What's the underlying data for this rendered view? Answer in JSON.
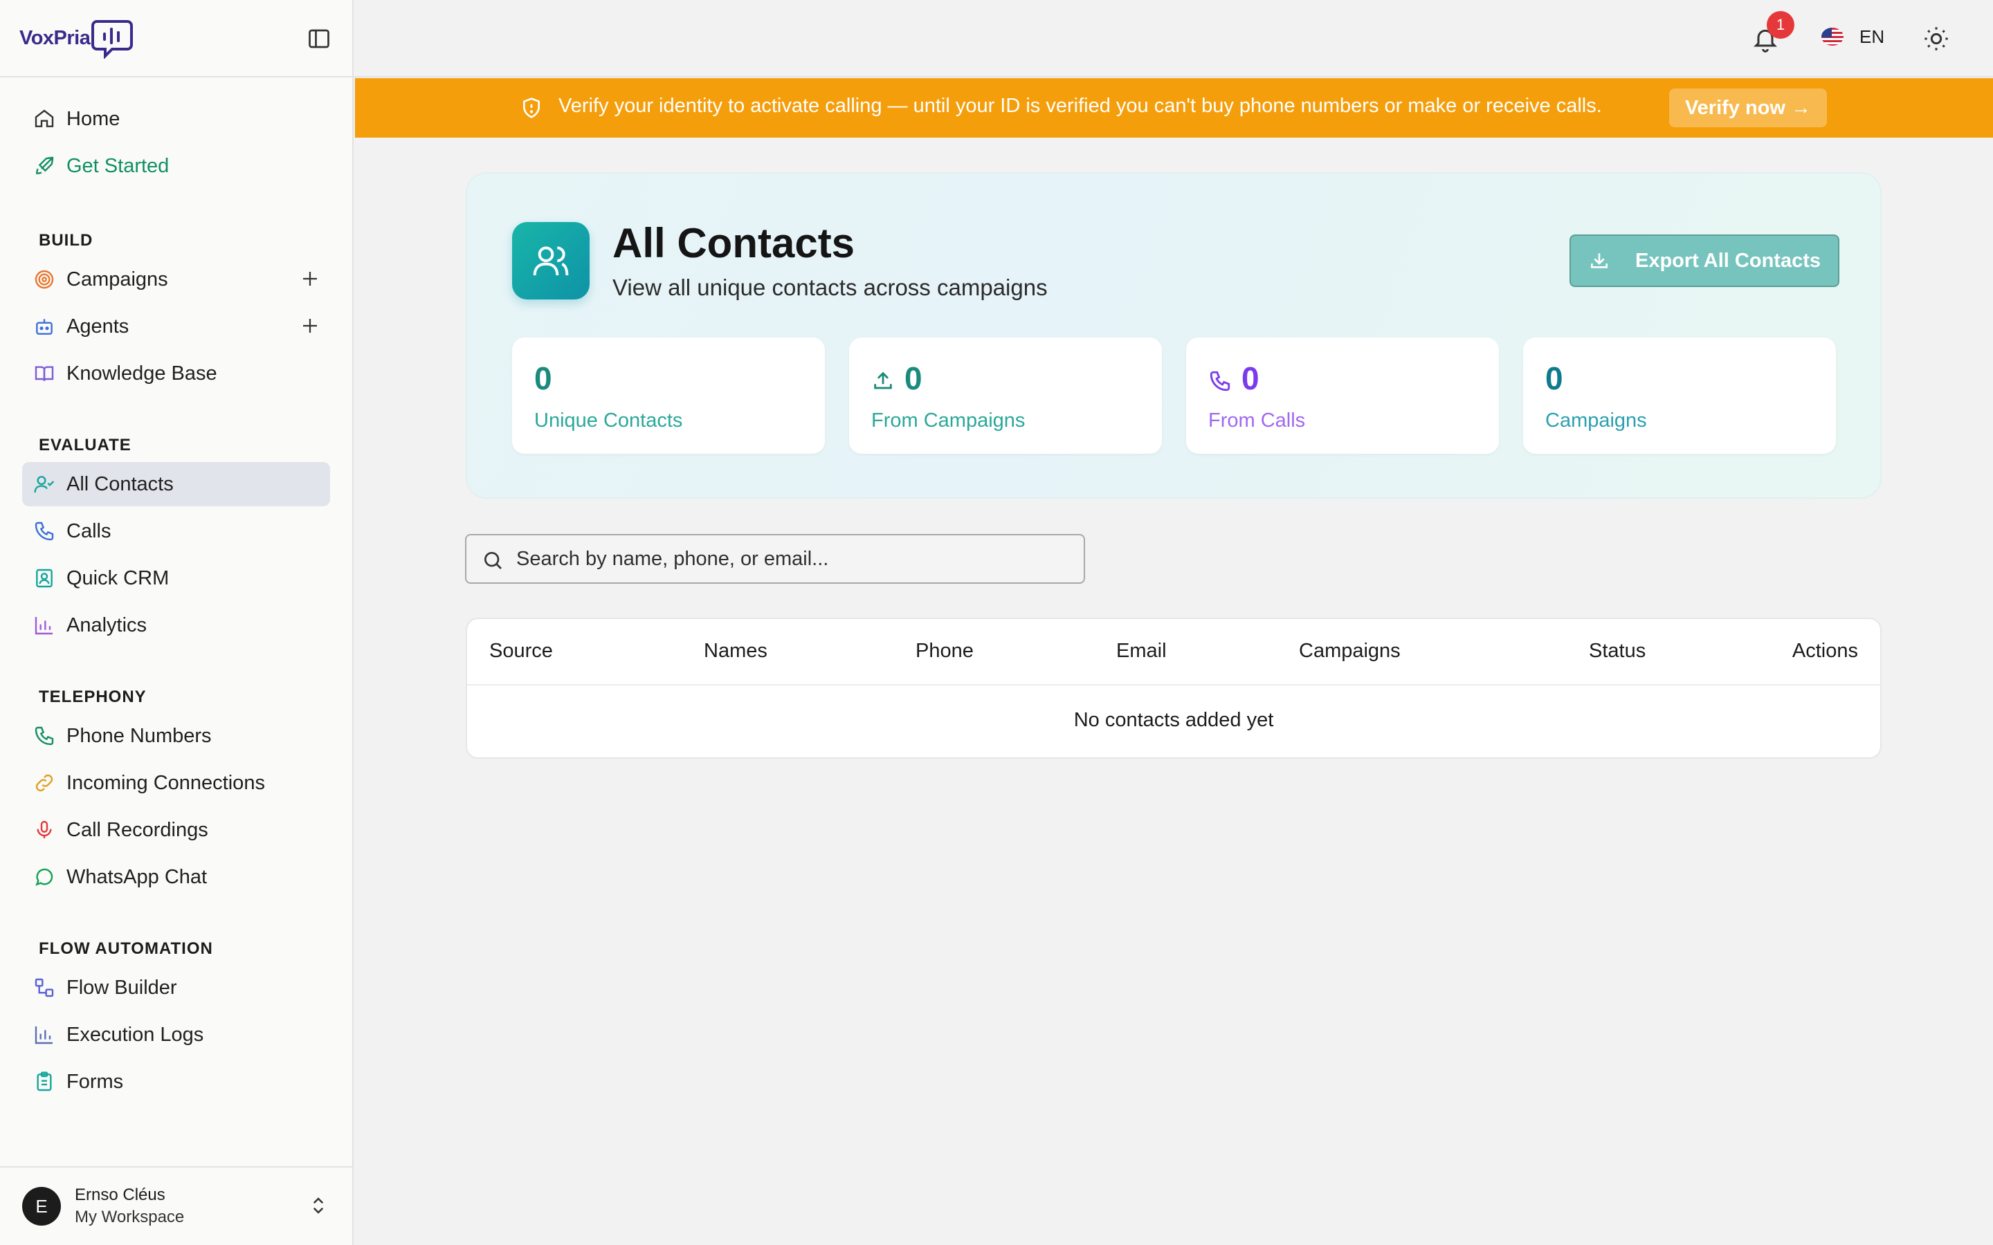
{
  "app": {
    "brand": "VoxPria"
  },
  "sidebar": {
    "top_items": [
      {
        "label": "Home"
      },
      {
        "label": "Get Started"
      }
    ],
    "sections": [
      {
        "title": "BUILD",
        "items": [
          {
            "label": "Campaigns"
          },
          {
            "label": "Agents"
          },
          {
            "label": "Knowledge Base"
          }
        ]
      },
      {
        "title": "EVALUATE",
        "items": [
          {
            "label": "All Contacts"
          },
          {
            "label": "Calls"
          },
          {
            "label": "Quick CRM"
          },
          {
            "label": "Analytics"
          }
        ]
      },
      {
        "title": "TELEPHONY",
        "items": [
          {
            "label": "Phone Numbers"
          },
          {
            "label": "Incoming Connections"
          },
          {
            "label": "Call Recordings"
          },
          {
            "label": "WhatsApp Chat"
          }
        ]
      },
      {
        "title": "FLOW AUTOMATION",
        "items": [
          {
            "label": "Flow Builder"
          },
          {
            "label": "Execution Logs"
          },
          {
            "label": "Forms"
          }
        ]
      }
    ],
    "user": {
      "initial": "E",
      "name": "Ernso Cléus",
      "workspace": "My Workspace"
    }
  },
  "topbar": {
    "notification_count": "1",
    "language": "EN"
  },
  "banner": {
    "message": "Verify your identity to activate calling — until your ID is verified you can't buy phone numbers or make or receive calls.",
    "button_label": "Verify now →"
  },
  "page": {
    "title": "All Contacts",
    "subtitle": "View all unique contacts across campaigns",
    "export_label": "Export All Contacts",
    "stats": [
      {
        "value": "0",
        "label": "Unique Contacts",
        "color": "#1a8a7c"
      },
      {
        "value": "0",
        "label": "From Campaigns",
        "color": "#1a8a7c"
      },
      {
        "value": "0",
        "label": "From Calls",
        "color": "#7c3aed"
      },
      {
        "value": "0",
        "label": "Campaigns",
        "color": "#0f7a8c"
      }
    ]
  },
  "search": {
    "placeholder": "Search by name, phone, or email..."
  },
  "table": {
    "columns": [
      "Source",
      "Names",
      "Phone",
      "Email",
      "Campaigns",
      "Status",
      "Actions"
    ],
    "empty_text": "No contacts added yet"
  },
  "colors": {
    "accent": "#14a69b",
    "banner": "#f59e0b",
    "active_bg": "#e1e4ea"
  }
}
